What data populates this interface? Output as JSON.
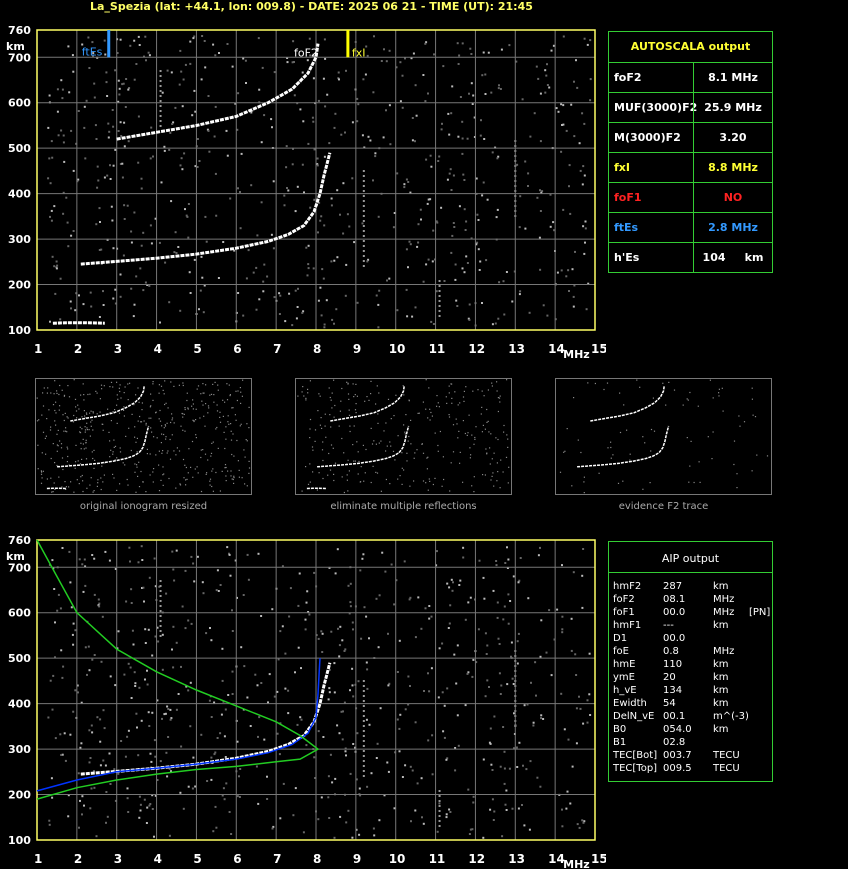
{
  "title": "La_Spezia (lat: +44.1, lon: 009.8) - DATE: 2025 06 21 - TIME (UT): 21:45",
  "axes": {
    "y_unit": "km",
    "x_unit": "MHz",
    "y_ticks": [
      "760",
      "700",
      "600",
      "500",
      "400",
      "300",
      "200",
      "100"
    ],
    "x_ticks": [
      "1",
      "2",
      "3",
      "4",
      "5",
      "6",
      "7",
      "8",
      "9",
      "10",
      "11",
      "12",
      "13",
      "14",
      "15"
    ]
  },
  "markers": {
    "ftEs_label": "ftEs",
    "foF2_label": "foF2",
    "fxI_label": "fxI"
  },
  "autoscala": {
    "title": "AUTOSCALA output",
    "rows": [
      {
        "key": "foF2",
        "value": "8.1 MHz",
        "key_color": "#ffffff",
        "value_color": "#ffffff"
      },
      {
        "key": "MUF(3000)F2",
        "value": "25.9 MHz",
        "key_color": "#ffffff",
        "value_color": "#ffffff"
      },
      {
        "key": "M(3000)F2",
        "value": "3.20",
        "key_color": "#ffffff",
        "value_color": "#ffffff"
      },
      {
        "key": "fxI",
        "value": "8.8 MHz",
        "key_color": "#ffff33",
        "value_color": "#ffff33"
      },
      {
        "key": "foF1",
        "value": "NO",
        "key_color": "#ff2222",
        "value_color": "#ff2222"
      },
      {
        "key": "ftEs",
        "value": "2.8 MHz",
        "key_color": "#3399ff",
        "value_color": "#3399ff"
      },
      {
        "key": "h'Es",
        "value": "104     km",
        "key_color": "#ffffff",
        "value_color": "#ffffff"
      }
    ]
  },
  "thumbnails": [
    {
      "caption": "original ionogram resized"
    },
    {
      "caption": "eliminate multiple reflections"
    },
    {
      "caption": "evidence F2 trace"
    }
  ],
  "aip": {
    "title": "AIP output",
    "rows": [
      [
        "hmF2",
        "287",
        "km",
        ""
      ],
      [
        "foF2",
        "08.1",
        "MHz",
        ""
      ],
      [
        "foF1",
        "00.0",
        "MHz",
        "[PN]"
      ],
      [
        "hmF1",
        "---",
        "km",
        ""
      ],
      [
        "D1",
        "00.0",
        "",
        ""
      ],
      [
        "foE",
        "0.8",
        "MHz",
        ""
      ],
      [
        "hmE",
        "110",
        "km",
        ""
      ],
      [
        "ymE",
        "20",
        "km",
        ""
      ],
      [
        "h_vE",
        "134",
        "km",
        ""
      ],
      [
        "Ewidth",
        "54",
        "km",
        ""
      ],
      [
        "DelN_vE",
        "00.1",
        "m^(-3)",
        ""
      ],
      [
        "B0",
        "054.0",
        "km",
        ""
      ],
      [
        "B1",
        "02.8",
        "",
        ""
      ],
      [
        "TEC[Bot]",
        "003.7",
        "TECU",
        ""
      ],
      [
        "TEC[Top]",
        "009.5",
        "TECU",
        ""
      ]
    ]
  },
  "chart_data": [
    {
      "type": "scatter",
      "title": "",
      "xlabel": "MHz",
      "ylabel": "km",
      "xlim": [
        1,
        15
      ],
      "ylim": [
        100,
        760
      ],
      "grid": true,
      "series": [
        {
          "name": "",
          "color": "#ffffff",
          "points": [
            [
              2.1,
              245
            ],
            [
              3,
              251
            ],
            [
              4,
              258
            ],
            [
              5,
              267
            ],
            [
              6,
              280
            ],
            [
              6.8,
              295
            ],
            [
              7.3,
              310
            ],
            [
              7.7,
              330
            ],
            [
              7.95,
              360
            ],
            [
              8.1,
              400
            ],
            [
              8.2,
              440
            ],
            [
              8.35,
              490
            ]
          ]
        },
        {
          "name": "",
          "color": "#ffffff",
          "points": [
            [
              3,
              520
            ],
            [
              4,
              535
            ],
            [
              5,
              550
            ],
            [
              6,
              570
            ],
            [
              6.8,
              600
            ],
            [
              7.4,
              630
            ],
            [
              7.8,
              665
            ],
            [
              8.0,
              700
            ],
            [
              8.05,
              730
            ]
          ]
        },
        {
          "name": "",
          "color": "#ffffff",
          "points": [
            [
              1.4,
              115
            ],
            [
              1.8,
              116
            ],
            [
              2.2,
              116
            ],
            [
              2.7,
              115
            ]
          ]
        }
      ],
      "markers": [
        {
          "label": "ftEs",
          "x": 2.8,
          "color": "#3399ff"
        },
        {
          "label": "fxI",
          "x": 8.8,
          "color": "#ffff00"
        }
      ]
    },
    {
      "type": "line",
      "title": "",
      "xlabel": "MHz",
      "ylabel": "km",
      "xlim": [
        1,
        15
      ],
      "ylim": [
        100,
        760
      ],
      "grid": true,
      "series": [
        {
          "name": "",
          "color": "#ffffff",
          "points": [
            [
              2.1,
              245
            ],
            [
              3,
              251
            ],
            [
              4,
              258
            ],
            [
              5,
              267
            ],
            [
              6,
              280
            ],
            [
              6.8,
              295
            ],
            [
              7.3,
              310
            ],
            [
              7.7,
              330
            ],
            [
              7.95,
              360
            ],
            [
              8.1,
              400
            ],
            [
              8.2,
              440
            ],
            [
              8.35,
              490
            ]
          ]
        },
        {
          "name": "",
          "color": "#0033ff",
          "points": [
            [
              1,
              208
            ],
            [
              2,
              232
            ],
            [
              3,
              250
            ],
            [
              4,
              258
            ],
            [
              5,
              267
            ],
            [
              6,
              278
            ],
            [
              6.8,
              292
            ],
            [
              7.4,
              310
            ],
            [
              7.8,
              335
            ],
            [
              8.0,
              370
            ],
            [
              8.05,
              420
            ],
            [
              8.08,
              470
            ],
            [
              8.1,
              500
            ]
          ]
        },
        {
          "name": "",
          "color": "#22cc22",
          "points": [
            [
              1,
              760
            ],
            [
              1.5,
              680
            ],
            [
              2,
              600
            ],
            [
              3,
              520
            ],
            [
              4,
              470
            ],
            [
              5,
              430
            ],
            [
              6,
              395
            ],
            [
              7,
              360
            ],
            [
              7.6,
              330
            ],
            [
              8.05,
              300
            ],
            [
              7.6,
              278
            ],
            [
              7,
              272
            ],
            [
              6,
              262
            ],
            [
              5,
              255
            ],
            [
              4,
              245
            ],
            [
              3,
              232
            ],
            [
              2,
              215
            ],
            [
              1,
              190
            ]
          ]
        }
      ]
    }
  ]
}
